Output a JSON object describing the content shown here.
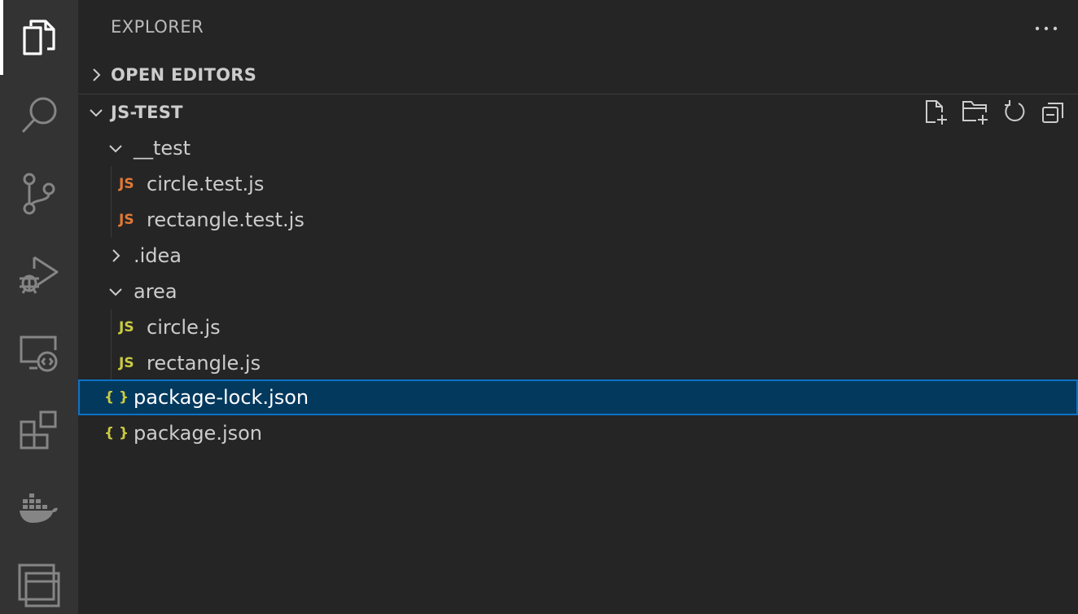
{
  "sidebar": {
    "header": "EXPLORER",
    "sections": {
      "open_editors": "OPEN EDITORS",
      "workspace": "JS-TEST"
    }
  },
  "tree": [
    {
      "label": "__test",
      "type": "folder",
      "expanded": true
    },
    {
      "label": "circle.test.js",
      "type": "js-test",
      "icon_text": "JS"
    },
    {
      "label": "rectangle.test.js",
      "type": "js-test",
      "icon_text": "JS"
    },
    {
      "label": ".idea",
      "type": "folder",
      "expanded": false
    },
    {
      "label": "area",
      "type": "folder",
      "expanded": true
    },
    {
      "label": "circle.js",
      "type": "js",
      "icon_text": "JS"
    },
    {
      "label": "rectangle.js",
      "type": "js",
      "icon_text": "JS"
    },
    {
      "label": "package-lock.json",
      "type": "json",
      "icon_text": "{ }",
      "selected": true
    },
    {
      "label": "package.json",
      "type": "json",
      "icon_text": "{ }"
    }
  ],
  "colors": {
    "js_test_icon": "#e37933",
    "js_icon": "#cbcb41",
    "json_icon": "#cbcb41",
    "selection_bg": "#04395e",
    "selection_border": "#0e72c4"
  }
}
